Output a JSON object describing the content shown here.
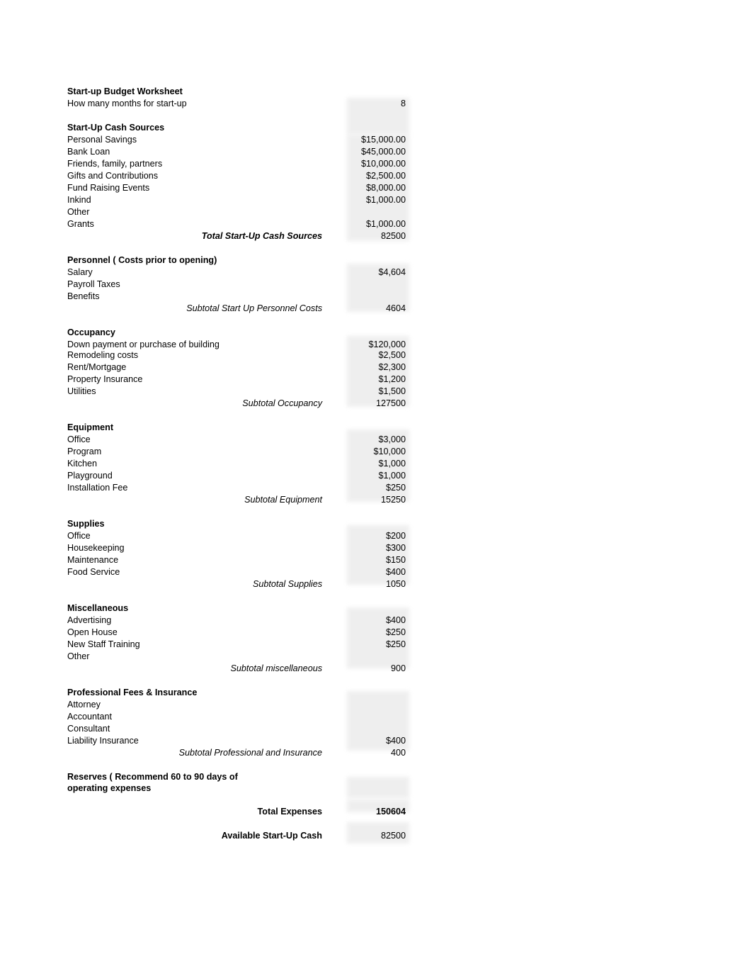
{
  "document": {
    "title": "Start-up Budget Worksheet",
    "months_label": "How many months for start-up",
    "months_value": "8"
  },
  "sections": [
    {
      "heading": "Start-Up Cash Sources",
      "rows": [
        {
          "label": "Personal Savings",
          "value": "$15,000.00"
        },
        {
          "label": "Bank Loan",
          "value": "$45,000.00"
        },
        {
          "label": "Friends, family, partners",
          "value": "$10,000.00"
        },
        {
          "label": "Gifts and Contributions",
          "value": "$2,500.00"
        },
        {
          "label": "Fund Raising Events",
          "value": "$8,000.00"
        },
        {
          "label": "Inkind",
          "value": "$1,000.00"
        },
        {
          "label": "Other",
          "value": ""
        },
        {
          "label": "Grants",
          "value": "$1,000.00"
        }
      ],
      "subtotal_label": "Total Start-Up Cash Sources",
      "subtotal_value": "82500",
      "subtotal_style": "bold-italic"
    },
    {
      "heading": "Personnel ( Costs prior to opening)",
      "rows": [
        {
          "label": "Salary",
          "value": "$4,604"
        },
        {
          "label": "Payroll Taxes",
          "value": ""
        },
        {
          "label": "Benefits",
          "value": ""
        }
      ],
      "subtotal_label": "Subtotal Start Up Personnel Costs",
      "subtotal_value": "4604",
      "subtotal_style": "italic"
    },
    {
      "heading": "Occupancy",
      "rows": [
        {
          "label": "Down payment or purchase of building",
          "value": "$120,000"
        },
        {
          "label": "Remodeling costs",
          "value": "$2,500"
        },
        {
          "label": "Rent/Mortgage",
          "value": "$2,300"
        },
        {
          "label": "Property Insurance",
          "value": "$1,200"
        },
        {
          "label": "Utilities",
          "value": "$1,500"
        }
      ],
      "subtotal_label": "Subtotal Occupancy",
      "subtotal_value": "127500",
      "subtotal_style": "italic"
    },
    {
      "heading": "Equipment",
      "rows": [
        {
          "label": "Office",
          "value": "$3,000"
        },
        {
          "label": "Program",
          "value": "$10,000"
        },
        {
          "label": "Kitchen",
          "value": "$1,000"
        },
        {
          "label": "Playground",
          "value": "$1,000"
        },
        {
          "label": "Installation Fee",
          "value": "$250"
        }
      ],
      "subtotal_label": "Subtotal Equipment",
      "subtotal_value": "15250",
      "subtotal_style": "italic"
    },
    {
      "heading": "Supplies",
      "rows": [
        {
          "label": "Office",
          "value": "$200"
        },
        {
          "label": "Housekeeping",
          "value": "$300"
        },
        {
          "label": "Maintenance",
          "value": "$150"
        },
        {
          "label": "Food Service",
          "value": "$400"
        }
      ],
      "subtotal_label": "Subtotal Supplies",
      "subtotal_value": "1050",
      "subtotal_style": "italic"
    },
    {
      "heading": "Miscellaneous",
      "rows": [
        {
          "label": "Advertising",
          "value": "$400"
        },
        {
          "label": "Open House",
          "value": "$250"
        },
        {
          "label": "New Staff Training",
          "value": "$250"
        },
        {
          "label": "Other",
          "value": ""
        }
      ],
      "subtotal_label": "Subtotal miscellaneous",
      "subtotal_value": "900",
      "subtotal_style": "italic"
    },
    {
      "heading": "Professional Fees & Insurance",
      "rows": [
        {
          "label": "Attorney",
          "value": ""
        },
        {
          "label": "Accountant",
          "value": ""
        },
        {
          "label": "Consultant",
          "value": ""
        },
        {
          "label": "Liability Insurance",
          "value": "$400"
        }
      ],
      "subtotal_label": "Subtotal Professional and Insurance",
      "subtotal_value": "400",
      "subtotal_style": "italic"
    }
  ],
  "reserves": {
    "heading": "Reserves ( Recommend 60 to 90 days of operating expenses",
    "value": ""
  },
  "totals": [
    {
      "label": "Total Expenses",
      "value": "150604",
      "bold_value": true
    },
    {
      "label": "Available Start-Up Cash",
      "value": "82500",
      "bold_value": false
    }
  ]
}
